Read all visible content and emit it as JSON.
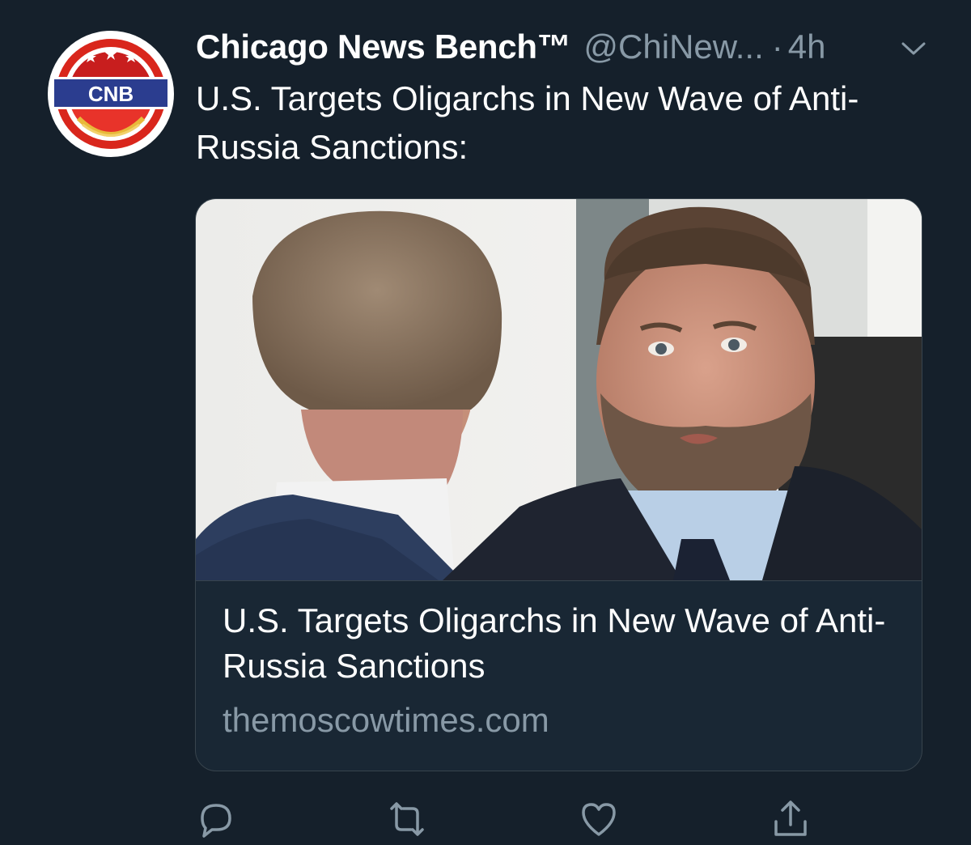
{
  "account": {
    "display_name": "Chicago News Bench™",
    "handle": "@ChiNew...",
    "separator": "·",
    "time": "4h",
    "avatar_text": "CNB"
  },
  "tweet": {
    "text": "U.S. Targets Oligarchs in New Wave of Anti-Russia Sanctions:"
  },
  "card": {
    "title": "U.S. Targets Oligarchs in New Wave of Anti-Russia Sanctions",
    "domain": "themoscowtimes.com"
  },
  "actions": [
    {
      "icon": "reply-icon"
    },
    {
      "icon": "retweet-icon"
    },
    {
      "icon": "like-icon"
    },
    {
      "icon": "share-icon"
    }
  ],
  "colors": {
    "background": "#15202b",
    "secondary_text": "#8899a6",
    "border": "#38444d",
    "card_bg": "#192734"
  }
}
